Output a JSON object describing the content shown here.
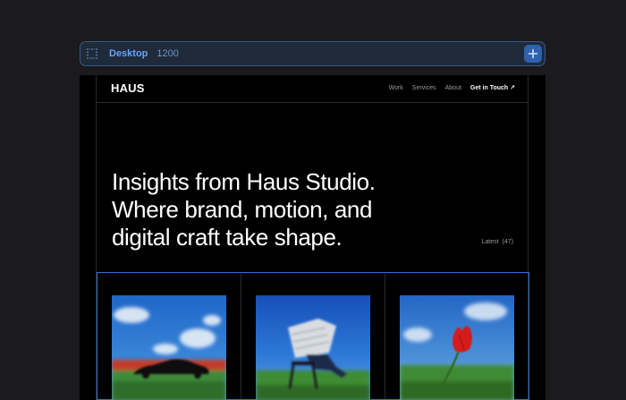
{
  "toolbar": {
    "breakpoint_name": "Desktop",
    "breakpoint_width": "1200",
    "grip_icon": "dotted-grid-icon",
    "add_icon": "plus-icon",
    "accent": "#63a4ff"
  },
  "site": {
    "logo": "HAUS",
    "nav": {
      "links": [
        "Work",
        "Services",
        "About"
      ],
      "cta": "Get in Touch ↗"
    },
    "hero": {
      "lines": [
        "Insights from Haus Studio.",
        "Where brand, motion, and",
        "digital craft take shape."
      ]
    },
    "latest": {
      "label": "Latest",
      "count": "(47)"
    },
    "cards": [
      {
        "image": "blurred-car-photo"
      },
      {
        "image": "person-reading-newspaper-photo"
      },
      {
        "image": "red-tulip-photo"
      }
    ]
  }
}
